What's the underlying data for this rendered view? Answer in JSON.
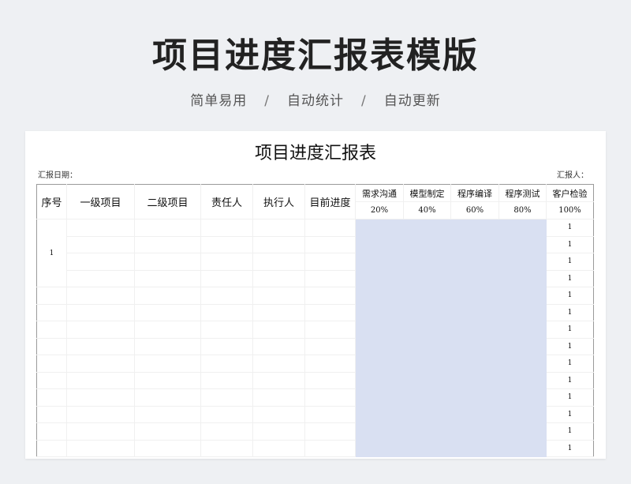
{
  "banner": {
    "title": "项目进度汇报表模版",
    "subtitle_items": [
      "简单易用",
      "自动统计",
      "自动更新"
    ],
    "separator": "/"
  },
  "document": {
    "title": "项目进度汇报表",
    "report_date_label": "汇报日期：",
    "reporter_label": "汇报人："
  },
  "table": {
    "columns": [
      "序号",
      "一级项目",
      "二级项目",
      "责任人",
      "执行人",
      "目前进度"
    ],
    "stages": [
      {
        "name": "需求沟通",
        "weight": "20%"
      },
      {
        "name": "模型制定",
        "weight": "40%"
      },
      {
        "name": "程序编译",
        "weight": "60%"
      },
      {
        "name": "程序测试",
        "weight": "80%"
      },
      {
        "name": "客户检验",
        "weight": "100%"
      }
    ],
    "first_row_index": "1",
    "rows": [
      {
        "check": "1"
      },
      {
        "check": "1"
      },
      {
        "check": "1"
      },
      {
        "check": "1"
      },
      {
        "check": "1"
      },
      {
        "check": "1"
      },
      {
        "check": "1"
      },
      {
        "check": "1"
      },
      {
        "check": "1"
      },
      {
        "check": "1"
      },
      {
        "check": "1"
      },
      {
        "check": "1"
      },
      {
        "check": "1"
      },
      {
        "check": "1"
      }
    ]
  },
  "colors": {
    "background": "#eef0f3",
    "paper": "#ffffff",
    "highlight": "#d9e0f2"
  }
}
